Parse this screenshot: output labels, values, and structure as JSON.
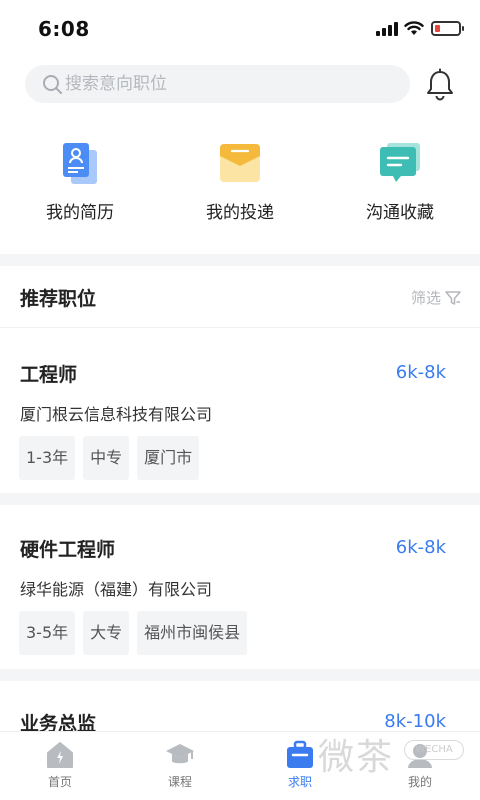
{
  "status_bar": {
    "time": "6:08"
  },
  "search": {
    "placeholder": "搜索意向职位"
  },
  "quick_entries": [
    {
      "label": "我的简历",
      "icon": "resume-icon",
      "color": "#4b8df5"
    },
    {
      "label": "我的投递",
      "icon": "envelope-icon",
      "color": "#f5b93b"
    },
    {
      "label": "沟通收藏",
      "icon": "chat-bubble-icon",
      "color": "#3dbdb3"
    }
  ],
  "section": {
    "title": "推荐职位",
    "filter_label": "筛选"
  },
  "jobs": [
    {
      "title": "工程师",
      "salary": "6k-8k",
      "company": "厦门根云信息科技有限公司",
      "tags": [
        "1-3年",
        "中专",
        "厦门市"
      ]
    },
    {
      "title": "硬件工程师",
      "salary": "6k-8k",
      "company": "绿华能源（福建）有限公司",
      "tags": [
        "3-5年",
        "大专",
        "福州市闽侯县"
      ]
    },
    {
      "title": "业务总监",
      "salary": "8k-10k",
      "company": "",
      "tags": []
    }
  ],
  "tab_bar": {
    "tabs": [
      {
        "label": "首页",
        "icon": "home-icon"
      },
      {
        "label": "课程",
        "icon": "graduation-cap-icon"
      },
      {
        "label": "求职",
        "icon": "briefcase-icon",
        "active": true
      },
      {
        "label": "我的",
        "icon": "profile-icon"
      }
    ]
  },
  "watermark": {
    "text": "微茶",
    "badge": "WECHA"
  },
  "colors": {
    "accent": "#3a7bf0",
    "band": "#f4f5f7"
  }
}
